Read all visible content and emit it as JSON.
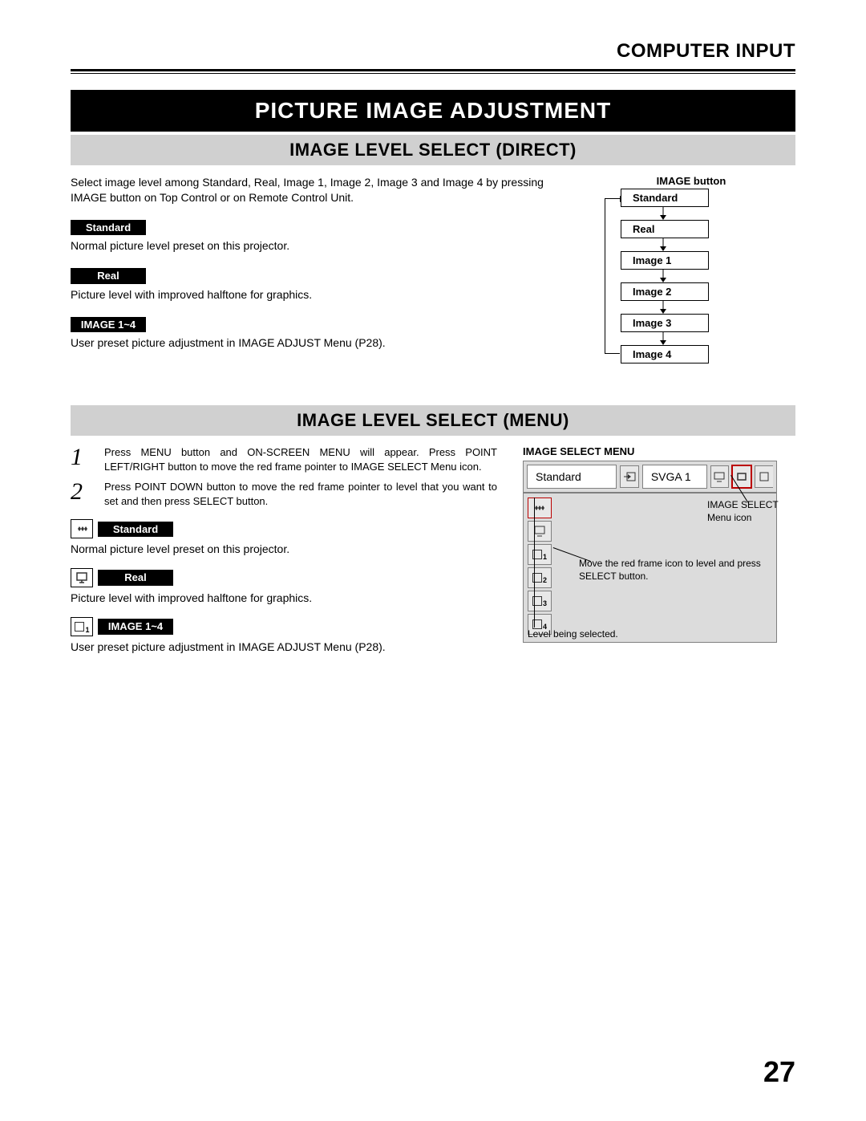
{
  "header": {
    "section": "COMPUTER INPUT"
  },
  "title_banner": "PICTURE IMAGE ADJUSTMENT",
  "direct": {
    "heading": "IMAGE LEVEL SELECT (DIRECT)",
    "intro": "Select image level among Standard, Real, Image 1, Image 2, Image 3 and Image 4 by pressing IMAGE button on Top Control or on Remote Control Unit.",
    "items": [
      {
        "label": "Standard",
        "desc": "Normal picture level preset on this projector."
      },
      {
        "label": "Real",
        "desc": "Picture level with improved halftone for graphics."
      },
      {
        "label": "IMAGE 1~4",
        "desc": "User preset picture adjustment in IMAGE ADJUST Menu (P28)."
      }
    ],
    "flow_title": "IMAGE button",
    "flow": [
      "Standard",
      "Real",
      "Image 1",
      "Image 2",
      "Image 3",
      "Image 4"
    ]
  },
  "menu": {
    "heading": "IMAGE LEVEL SELECT (MENU)",
    "steps": [
      "Press MENU button and ON-SCREEN MENU will appear. Press POINT LEFT/RIGHT button to move the red frame pointer to IMAGE SELECT Menu icon.",
      "Press POINT DOWN button to move the red frame pointer to level that you want to set and then press SELECT button."
    ],
    "items": [
      {
        "label": "Standard",
        "desc": "Normal picture level preset on this projector."
      },
      {
        "label": "Real",
        "desc": "Picture level with improved halftone for graphics."
      },
      {
        "label": "IMAGE 1~4",
        "desc": "User preset picture adjustment in IMAGE ADJUST Menu (P28)."
      }
    ],
    "ui_title": "IMAGE SELECT MENU",
    "ui": {
      "field1": "Standard",
      "field2": "SVGA 1",
      "side_labels": [
        "",
        "",
        "1",
        "2",
        "3",
        "4"
      ],
      "annot_icon": "IMAGE SELECT Menu icon",
      "annot_move": "Move the red frame icon to level and press SELECT button.",
      "annot_level": "Level being selected."
    }
  },
  "page_number": "27"
}
